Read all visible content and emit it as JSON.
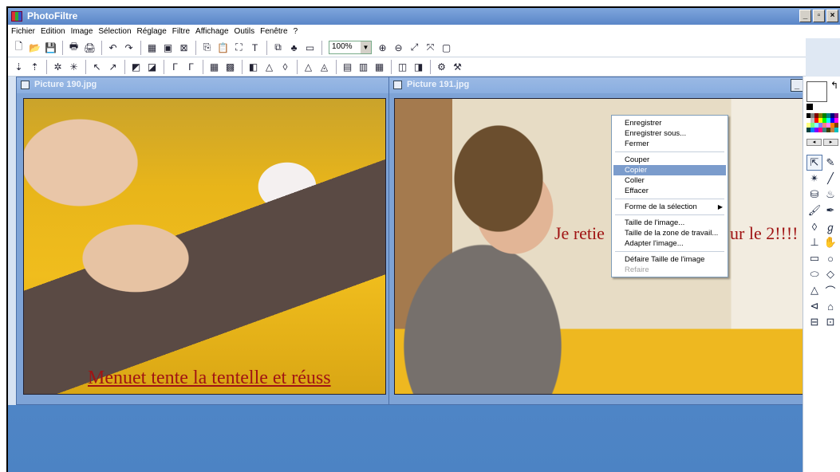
{
  "app": {
    "title": "PhotoFiltre"
  },
  "window_buttons": [
    "_",
    "▫",
    "×"
  ],
  "menu": [
    "Fichier",
    "Edition",
    "Image",
    "Sélection",
    "Réglage",
    "Filtre",
    "Affichage",
    "Outils",
    "Fenêtre",
    "?"
  ],
  "toolbar1": {
    "icons": [
      "new-file-icon",
      "open-folder-icon",
      "save-icon",
      "sep",
      "print-icon",
      "scan-icon",
      "sep",
      "undo-icon",
      "redo-icon",
      "sep",
      "grayscale-icon",
      "rgb-icon",
      "filter-icon",
      "sep",
      "copy-icon",
      "paste-icon",
      "crop-icon",
      "text-icon",
      "sep",
      "layers-icon",
      "plugin-icon",
      "fullscreen-icon",
      "sep",
      "zoom-select",
      "zoom-in-icon",
      "zoom-out-icon",
      "fit-icon",
      "actual-size-icon",
      "window-icon"
    ],
    "glyphs": [
      "🗋",
      "📂",
      "💾",
      "|",
      "🖶",
      "🖨",
      "|",
      "↶",
      "↷",
      "|",
      "▦",
      "▣",
      "⊠",
      "|",
      "⎘",
      "📋",
      "⛶",
      "T",
      "|",
      "⧉",
      "♣",
      "▭",
      "|",
      "",
      "⊕",
      "⊖",
      "⤢",
      "⤧",
      "▢"
    ],
    "zoom_value": "100%"
  },
  "toolbar2": {
    "glyphs": [
      "⇣",
      "⇡",
      "|",
      "✲",
      "✳",
      "|",
      "↖",
      "↗",
      "|",
      "◩",
      "◪",
      "|",
      "Γ",
      "Γ",
      "|",
      "▦",
      "▩",
      "|",
      "◧",
      "△",
      "◊",
      "|",
      "△",
      "◬",
      "|",
      "▤",
      "▥",
      "▦",
      "|",
      "◫",
      "◨",
      "|",
      "⚙",
      "⚒"
    ]
  },
  "documents": [
    {
      "title": "Picture 190.jpg",
      "caption": "Menuet tente la tentelle et réuss"
    },
    {
      "title": "Picture 191.jpg",
      "caption_left": "Je retie",
      "caption_right": "ur le 2!!!!",
      "control": "_"
    }
  ],
  "context_menu": [
    {
      "label": "Enregistrer",
      "type": "item"
    },
    {
      "label": "Enregistrer sous...",
      "type": "item"
    },
    {
      "label": "Fermer",
      "type": "item"
    },
    {
      "type": "sep"
    },
    {
      "label": "Couper",
      "type": "item"
    },
    {
      "label": "Copier",
      "type": "selected"
    },
    {
      "label": "Coller",
      "type": "item"
    },
    {
      "label": "Effacer",
      "type": "item"
    },
    {
      "type": "sep"
    },
    {
      "label": "Forme de la sélection",
      "type": "submenu"
    },
    {
      "type": "sep"
    },
    {
      "label": "Taille de l'image...",
      "type": "item"
    },
    {
      "label": "Taille de la zone de travail...",
      "type": "item"
    },
    {
      "label": "Adapter l'image...",
      "type": "item"
    },
    {
      "type": "sep"
    },
    {
      "label": "Défaire Taille de l'image",
      "type": "item"
    },
    {
      "label": "Refaire",
      "type": "disabled"
    }
  ],
  "palette_colors": [
    "#000000",
    "#808080",
    "#800000",
    "#808000",
    "#008000",
    "#008080",
    "#000080",
    "#800080",
    "#ffffff",
    "#c0c0c0",
    "#ff0000",
    "#ffff00",
    "#00ff00",
    "#00ffff",
    "#0000ff",
    "#ff00ff",
    "#ffff80",
    "#80ff80",
    "#80ffff",
    "#8080ff",
    "#ff8080",
    "#ff80ff",
    "#ff8000",
    "#804000",
    "#004040",
    "#0080ff",
    "#8000ff",
    "#ff0080",
    "#408080",
    "#404000",
    "#c08040",
    "#00c0c0"
  ],
  "side_tools": [
    {
      "name": "select-arrow-icon",
      "glyph": "⇱",
      "active": true
    },
    {
      "name": "color-picker-icon",
      "glyph": "✎"
    },
    {
      "name": "magic-wand-icon",
      "glyph": "✴"
    },
    {
      "name": "line-icon",
      "glyph": "╱"
    },
    {
      "name": "fill-bucket-icon",
      "glyph": "⛁"
    },
    {
      "name": "spray-icon",
      "glyph": "♨"
    },
    {
      "name": "brush-icon",
      "glyph": "🖌"
    },
    {
      "name": "advanced-brush-icon",
      "glyph": "✒"
    },
    {
      "name": "blur-drop-icon",
      "glyph": "◊"
    },
    {
      "name": "smudge-icon",
      "glyph": "ℊ"
    },
    {
      "name": "stamp-icon",
      "glyph": "⊥"
    },
    {
      "name": "hand-icon",
      "glyph": "✋"
    },
    {
      "name": "rectangle-icon",
      "glyph": "▭"
    },
    {
      "name": "ellipse-icon",
      "glyph": "○"
    },
    {
      "name": "rounded-rect-icon",
      "glyph": "⬭"
    },
    {
      "name": "diamond-icon",
      "glyph": "◇"
    },
    {
      "name": "triangle-icon",
      "glyph": "△"
    },
    {
      "name": "lasso-icon",
      "glyph": "⌒"
    },
    {
      "name": "polygon-lasso-icon",
      "glyph": "⊲"
    },
    {
      "name": "open-shape-icon",
      "glyph": "⌂"
    },
    {
      "name": "select-all-icon",
      "glyph": "⊟"
    },
    {
      "name": "invert-select-icon",
      "glyph": "⊡"
    }
  ]
}
